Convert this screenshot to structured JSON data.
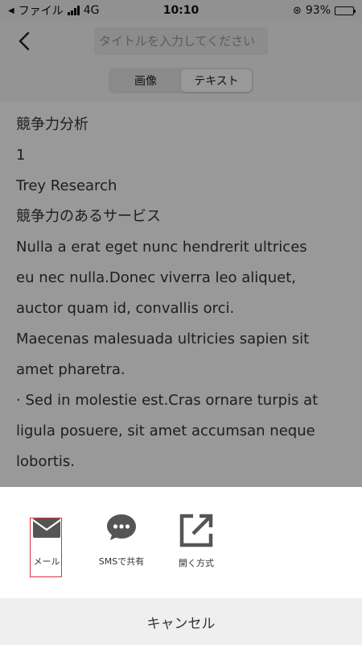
{
  "status_bar": {
    "carrier": "ファイル",
    "network": "4G",
    "time": "10:10",
    "battery_percent_text": "93%",
    "battery_level": 0.93
  },
  "nav": {
    "back_icon": "chevron-left-icon",
    "title_placeholder": "タイトルを入力してください"
  },
  "segments": {
    "image_label": "画像",
    "text_label": "テキスト",
    "selected": "テキスト"
  },
  "content": {
    "lines": [
      "競争力分析",
      "1",
      "Trey Research",
      "競争力のあるサービス",
      "Nulla a erat eget nunc hendrerit ultrices",
      "eu nec nulla.Donec viverra leo aliquet,",
      "auctor quam id, convallis orci.",
      "Maecenas malesuada ultricies sapien sit",
      "amet pharetra.",
      "· Sed in molestie est.Cras ornare turpis at",
      "ligula posuere, sit amet accumsan neque",
      "lobortis."
    ]
  },
  "share_sheet": {
    "items": [
      {
        "label": "メール",
        "icon": "mail-icon"
      },
      {
        "label": "SMSで共有",
        "icon": "chat-bubble-icon"
      },
      {
        "label": "開く方式",
        "icon": "open-external-icon"
      }
    ],
    "cancel_label": "キャンセル"
  },
  "colors": {
    "icon_gray": "#555555",
    "highlight_red": "#e0303a",
    "overlay": "rgba(0,0,0,0.4)"
  }
}
